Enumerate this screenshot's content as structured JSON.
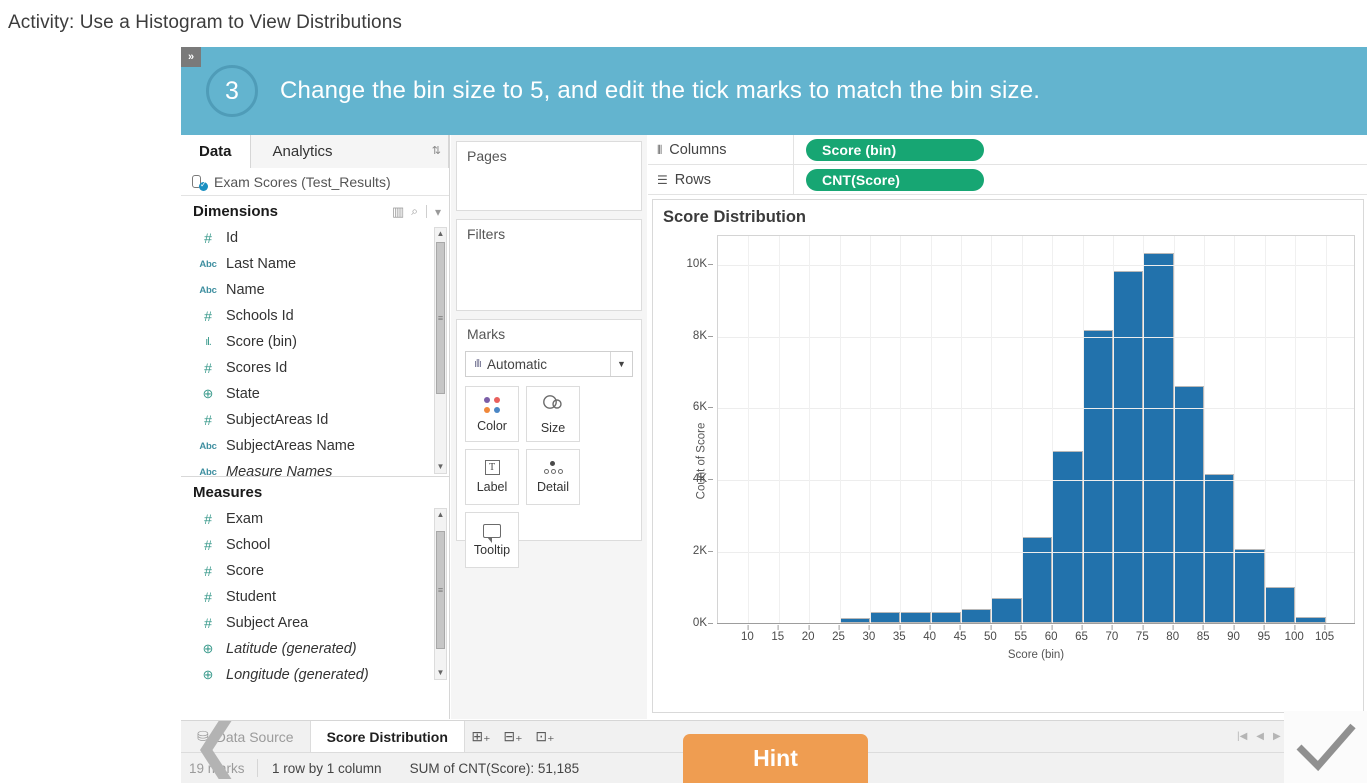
{
  "activity": {
    "title": "Activity: Use a Histogram to View Distributions"
  },
  "banner": {
    "step_number": "3",
    "instruction": "Change the bin size to 5, and edit the tick marks to match the bin size.",
    "collapse_icon": "»",
    "bg_color": "#63b4cf"
  },
  "left_pane": {
    "tabs": [
      {
        "label": "Data",
        "active": true
      },
      {
        "label": "Analytics",
        "active": false
      }
    ],
    "tab_caret_icon": "chevron-updown-icon",
    "datasource": {
      "name": "Exam Scores (Test_Results)",
      "icon": "database-check-icon"
    },
    "dimensions": {
      "header": "Dimensions",
      "grid_icon": "grid-view-icon",
      "search_icon": "search-icon",
      "caret_icon": "chevron-down-icon",
      "fields": [
        {
          "icon": "#",
          "kind": "number",
          "label": "Id",
          "italic": false
        },
        {
          "icon": "Abc",
          "kind": "text",
          "label": "Last Name",
          "italic": false
        },
        {
          "icon": "Abc",
          "kind": "text",
          "label": "Name",
          "italic": false
        },
        {
          "icon": "#",
          "kind": "number",
          "label": "Schools Id",
          "italic": false
        },
        {
          "icon": "ıl.",
          "kind": "bin",
          "label": "Score (bin)",
          "italic": false
        },
        {
          "icon": "#",
          "kind": "number",
          "label": "Scores Id",
          "italic": false
        },
        {
          "icon": "⊕",
          "kind": "geo",
          "label": "State",
          "italic": false
        },
        {
          "icon": "#",
          "kind": "number",
          "label": "SubjectAreas Id",
          "italic": false
        },
        {
          "icon": "Abc",
          "kind": "text",
          "label": "SubjectAreas Name",
          "italic": false
        },
        {
          "icon": "Abc",
          "kind": "text",
          "label": "Measure Names",
          "italic": true
        }
      ]
    },
    "measures": {
      "header": "Measures",
      "fields": [
        {
          "icon": "#",
          "kind": "number",
          "label": "Exam",
          "italic": false
        },
        {
          "icon": "#",
          "kind": "number",
          "label": "School",
          "italic": false
        },
        {
          "icon": "#",
          "kind": "number",
          "label": "Score",
          "italic": false
        },
        {
          "icon": "#",
          "kind": "number",
          "label": "Student",
          "italic": false
        },
        {
          "icon": "#",
          "kind": "number",
          "label": "Subject Area",
          "italic": false
        },
        {
          "icon": "⊕",
          "kind": "geo",
          "label": "Latitude (generated)",
          "italic": true
        },
        {
          "icon": "⊕",
          "kind": "geo",
          "label": "Longitude (generated)",
          "italic": true
        }
      ]
    }
  },
  "cards": {
    "pages": {
      "title": "Pages"
    },
    "filters": {
      "title": "Filters"
    },
    "marks": {
      "title": "Marks",
      "mark_type": "Automatic",
      "mark_type_icon": "bar-mark-icon",
      "dropdown_icon": "chevron-down-icon",
      "buttons": [
        {
          "label": "Color",
          "icon": "color-dots-icon"
        },
        {
          "label": "Size",
          "icon": "size-circles-icon"
        },
        {
          "label": "Label",
          "icon": "text-label-icon"
        },
        {
          "label": "Detail",
          "icon": "detail-dots-icon"
        },
        {
          "label": "Tooltip",
          "icon": "tooltip-bubble-icon"
        }
      ]
    }
  },
  "shelves": [
    {
      "label": "Columns",
      "icon": "columns-icon",
      "pill": "Score (bin)"
    },
    {
      "label": "Rows",
      "icon": "rows-icon",
      "pill": "CNT(Score)"
    }
  ],
  "pill_color": "#17a673",
  "view": {
    "title": "Score Distribution"
  },
  "chart_data": {
    "type": "bar",
    "title": "Score Distribution",
    "xlabel": "Score (bin)",
    "ylabel": "Count of Score",
    "xlim": [
      5,
      110
    ],
    "ylim": [
      0,
      10800
    ],
    "grid": true,
    "bar_color": "#2272ac",
    "bin_size": 5,
    "x_ticks": [
      "10",
      "15",
      "20",
      "25",
      "30",
      "35",
      "40",
      "45",
      "50",
      "55",
      "60",
      "65",
      "70",
      "75",
      "80",
      "85",
      "90",
      "95",
      "100",
      "105"
    ],
    "y_ticks": [
      "0K",
      "2K",
      "4K",
      "6K",
      "8K",
      "10K"
    ],
    "y_tick_values": [
      0,
      2000,
      4000,
      6000,
      8000,
      10000
    ],
    "categories": [
      "25",
      "30",
      "35",
      "40",
      "45",
      "50",
      "55",
      "60",
      "65",
      "70",
      "75",
      "80",
      "85",
      "90",
      "95",
      "100"
    ],
    "values": [
      130,
      320,
      320,
      320,
      400,
      700,
      2400,
      4800,
      8150,
      9800,
      10300,
      6600,
      4150,
      2050,
      1000,
      180
    ]
  },
  "sheet_tabs": {
    "data_source": {
      "label": "Data Source",
      "icon": "database-icon"
    },
    "sheets": [
      {
        "label": "Score Distribution",
        "active": true
      }
    ],
    "new_buttons": [
      {
        "icon": "new-worksheet-icon"
      },
      {
        "icon": "new-dashboard-icon"
      },
      {
        "icon": "new-story-icon"
      }
    ],
    "nav_icons": [
      "first-page-icon",
      "prev-page-icon",
      "next-page-icon",
      "last-page-icon"
    ],
    "view_icons": [
      "show-tabs-icon",
      "show-filmstrip-icon",
      "show-sheet-icon"
    ]
  },
  "status_bar": {
    "marks": "19 marks",
    "rows_cols": "1 row by 1 column",
    "aggregate": "SUM of CNT(Score): 51,185"
  },
  "overlays": {
    "back_arrow_icon": "back-arrow-icon",
    "hint_label": "Hint",
    "hint_color": "#ef9d51",
    "check_icon": "checkmark-icon"
  }
}
